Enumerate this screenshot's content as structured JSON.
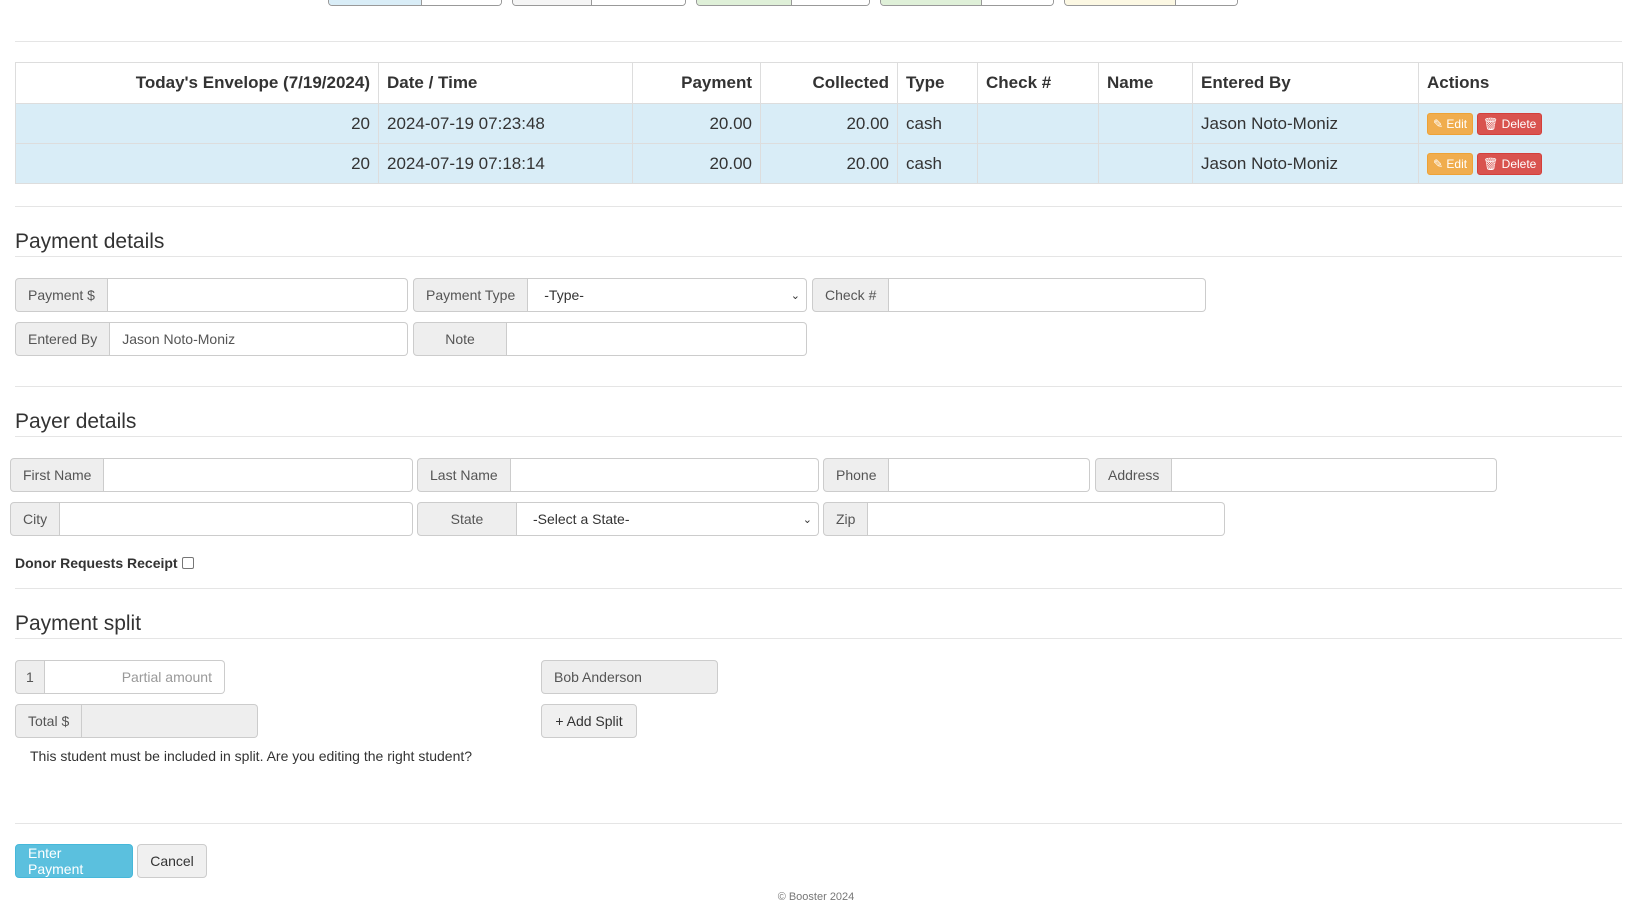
{
  "colors": {
    "row_highlight": "#d9edf7",
    "edit_button": "#f0ad4e",
    "delete_button": "#d9534f",
    "primary_button": "#5bc0de",
    "top_buttons": [
      "#d9edf7",
      "#f5f5f5",
      "#dff0d8",
      "#dff0d8",
      "#fcf8e3"
    ]
  },
  "envelope_table": {
    "headers": {
      "envelope": "Today's Envelope (7/19/2024)",
      "datetime": "Date / Time",
      "payment": "Payment",
      "collected": "Collected",
      "type": "Type",
      "check": "Check #",
      "name": "Name",
      "entered_by": "Entered By",
      "actions": "Actions"
    },
    "rows": [
      {
        "envelope": "20",
        "datetime": "2024-07-19 07:23:48",
        "payment": "20.00",
        "collected": "20.00",
        "type": "cash",
        "check": "",
        "name": "",
        "entered_by": "Jason Noto-Moniz",
        "edit_label": "Edit",
        "delete_label": "Delete",
        "edit_icon": "pencil-icon",
        "delete_icon": "trash-icon"
      },
      {
        "envelope": "20",
        "datetime": "2024-07-19 07:18:14",
        "payment": "20.00",
        "collected": "20.00",
        "type": "cash",
        "check": "",
        "name": "",
        "entered_by": "Jason Noto-Moniz",
        "edit_label": "Edit",
        "delete_label": "Delete",
        "edit_icon": "pencil-icon",
        "delete_icon": "trash-icon"
      }
    ]
  },
  "payment_details": {
    "title": "Payment details",
    "payment_label": "Payment $",
    "payment_value": "",
    "payment_type_label": "Payment Type",
    "payment_type_selected": "-Type-",
    "check_label": "Check #",
    "check_value": "",
    "entered_by_label": "Entered By",
    "entered_by_value": "Jason Noto-Moniz",
    "note_label": "Note",
    "note_value": ""
  },
  "payer_details": {
    "title": "Payer details",
    "first_name_label": "First Name",
    "first_name_value": "",
    "last_name_label": "Last Name",
    "last_name_value": "",
    "phone_label": "Phone",
    "phone_value": "",
    "address_label": "Address",
    "address_value": "",
    "city_label": "City",
    "city_value": "",
    "state_label": "State",
    "state_selected": "-Select a State-",
    "zip_label": "Zip",
    "zip_value": "",
    "receipt_label": "Donor Requests Receipt",
    "receipt_checked": false
  },
  "payment_split": {
    "title": "Payment split",
    "index": "1",
    "partial_placeholder": "Partial amount",
    "student_name": "Bob Anderson",
    "total_label": "Total $",
    "total_value": "",
    "add_split_label": "+ Add Split",
    "warning": "This student must be included in split. Are you editing the right student?"
  },
  "actions": {
    "enter_payment_label": "Enter Payment",
    "cancel_label": "Cancel"
  },
  "footer": {
    "text": "© Booster 2024"
  }
}
